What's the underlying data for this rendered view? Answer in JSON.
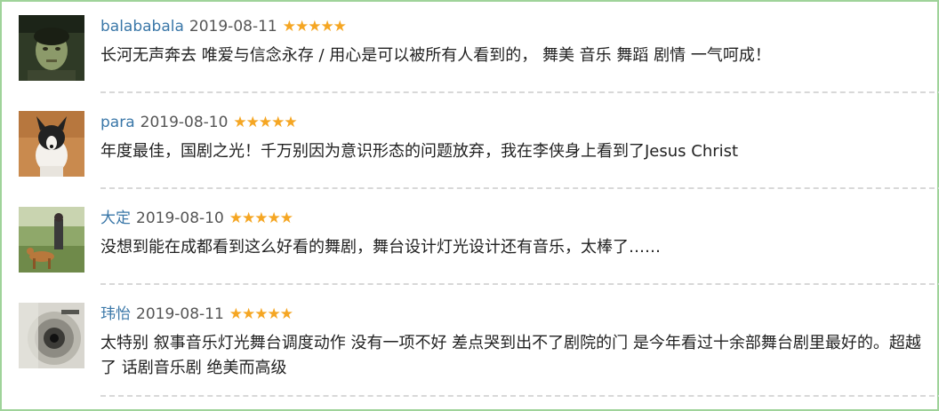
{
  "reviews": [
    {
      "user": "balababala",
      "date": "2019-08-11",
      "stars": "★★★★★",
      "rating": 5,
      "comment": "长河无声奔去 唯爱与信念永存 / 用心是可以被所有人看到的， 舞美 音乐 舞蹈 剧情 一气呵成！"
    },
    {
      "user": "para",
      "date": "2019-08-10",
      "stars": "★★★★★",
      "rating": 5,
      "comment": "年度最佳，国剧之光！千万别因为意识形态的问题放弃，我在李侠身上看到了Jesus Christ"
    },
    {
      "user": "大定",
      "date": "2019-08-10",
      "stars": "★★★★★",
      "rating": 5,
      "comment": "没想到能在成都看到这么好看的舞剧，舞台设计灯光设计还有音乐，太棒了……"
    },
    {
      "user": "玮怡",
      "date": "2019-08-11",
      "stars": "★★★★★",
      "rating": 5,
      "comment": "太特别 叙事音乐灯光舞台调度动作 没有一项不好 差点哭到出不了剧院的门 是今年看过十余部舞台剧里最好的。超越了 话剧音乐剧 绝美而高级"
    }
  ],
  "colors": {
    "border": "#9fd39a",
    "username": "#3a77a8",
    "star": "#f5a623",
    "divider": "#d8d8d8"
  }
}
